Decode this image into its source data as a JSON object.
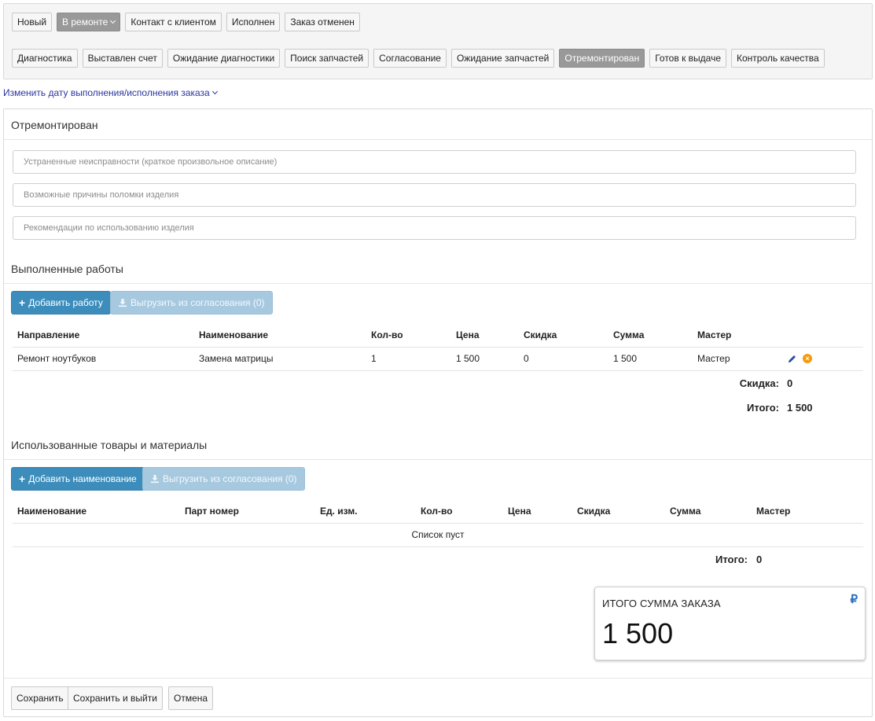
{
  "statuses_main": [
    {
      "label": "Новый",
      "active": false
    },
    {
      "label": "В ремонте",
      "active": true
    },
    {
      "label": "Контакт с клиентом",
      "active": false
    },
    {
      "label": "Исполнен",
      "active": false
    },
    {
      "label": "Заказ отменен",
      "active": false
    }
  ],
  "statuses_sub": [
    {
      "label": "Диагностика",
      "active": false
    },
    {
      "label": "Выставлен счет",
      "active": false
    },
    {
      "label": "Ожидание диагностики",
      "active": false
    },
    {
      "label": "Поиск запчастей",
      "active": false
    },
    {
      "label": "Согласование",
      "active": false
    },
    {
      "label": "Ожидание запчастей",
      "active": false
    },
    {
      "label": "Отремонтирован",
      "active": true
    },
    {
      "label": "Готов к выдаче",
      "active": false
    },
    {
      "label": "Контроль качества",
      "active": false
    }
  ],
  "change_date_link": "Изменить дату выполнения/исполнения заказа",
  "section_title": "Отремонтирован",
  "fields": {
    "faults_placeholder": "Устраненные неисправности (краткое произвольное описание)",
    "causes_placeholder": "Возможные причины поломки изделия",
    "recommendations_placeholder": "Рекомендации по использованию изделия",
    "faults_value": "",
    "causes_value": "",
    "recommendations_value": ""
  },
  "works": {
    "title": "Выполненные работы",
    "add_button": "Добавить работу",
    "export_button": "Выгрузить из согласования (0)",
    "headers": [
      "Направление",
      "Наименование",
      "Кол-во",
      "Цена",
      "Скидка",
      "Сумма",
      "Мастер"
    ],
    "rows": [
      [
        "Ремонт ноутбуков",
        "Замена матрицы",
        "1",
        "1 500",
        "0",
        "1 500",
        "Мастер"
      ]
    ],
    "discount_label": "Скидка:",
    "discount_value": "0",
    "total_label": "Итого:",
    "total_value": "1 500"
  },
  "materials": {
    "title": "Использованные товары и материалы",
    "add_button": "Добавить наименование",
    "export_button": "Выгрузить из согласования (0)",
    "headers": [
      "Наименование",
      "Парт номер",
      "Ед. изм.",
      "Кол-во",
      "Цена",
      "Скидка",
      "Сумма",
      "Мастер"
    ],
    "empty_text": "Список пуст",
    "total_label": "Итого:",
    "total_value": "0"
  },
  "order_total": {
    "label": "ИТОГО СУММА ЗАКАЗА",
    "value": "1 500",
    "currency_symbol": "₽"
  },
  "footer": {
    "save": "Сохранить",
    "save_exit": "Сохранить и выйти",
    "cancel": "Отмена"
  },
  "colors": {
    "primary": "#3c8dbc",
    "active_status": "#999999",
    "link": "#2a35a0",
    "delete_icon": "#f39c12"
  }
}
